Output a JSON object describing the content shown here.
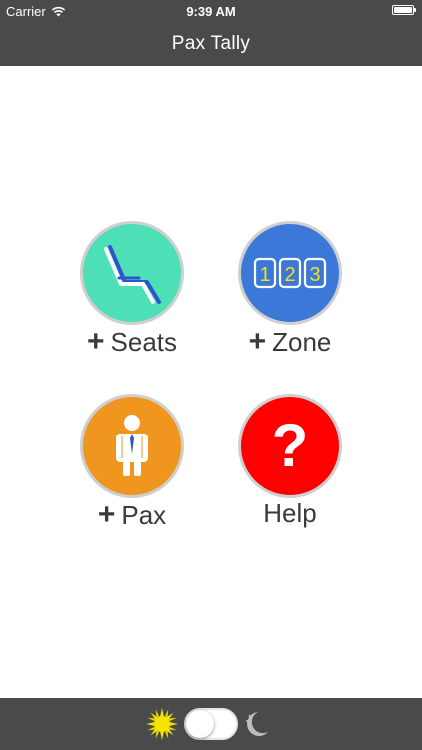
{
  "status_bar": {
    "carrier": "Carrier",
    "time": "9:39 AM"
  },
  "nav": {
    "title": "Pax Tally"
  },
  "tiles": {
    "seats": {
      "plus": "+",
      "label": "Seats",
      "icon": "seat-icon",
      "color": "#4ddfb5"
    },
    "zone": {
      "plus": "+",
      "label": "Zone",
      "icon": "zone-numbers-icon",
      "color": "#3b78d8",
      "digits": [
        "1",
        "2",
        "3"
      ]
    },
    "pax": {
      "plus": "+",
      "label": "Pax",
      "icon": "passenger-icon",
      "color": "#f0951e"
    },
    "help": {
      "label": "Help",
      "icon": "question-mark-icon",
      "color": "#ff0000",
      "symbol": "?"
    }
  },
  "theme_toggle": {
    "left_icon": "sun-icon",
    "right_icon": "moon-icon",
    "mode": "light",
    "bar_color": "#4a4a4a"
  }
}
